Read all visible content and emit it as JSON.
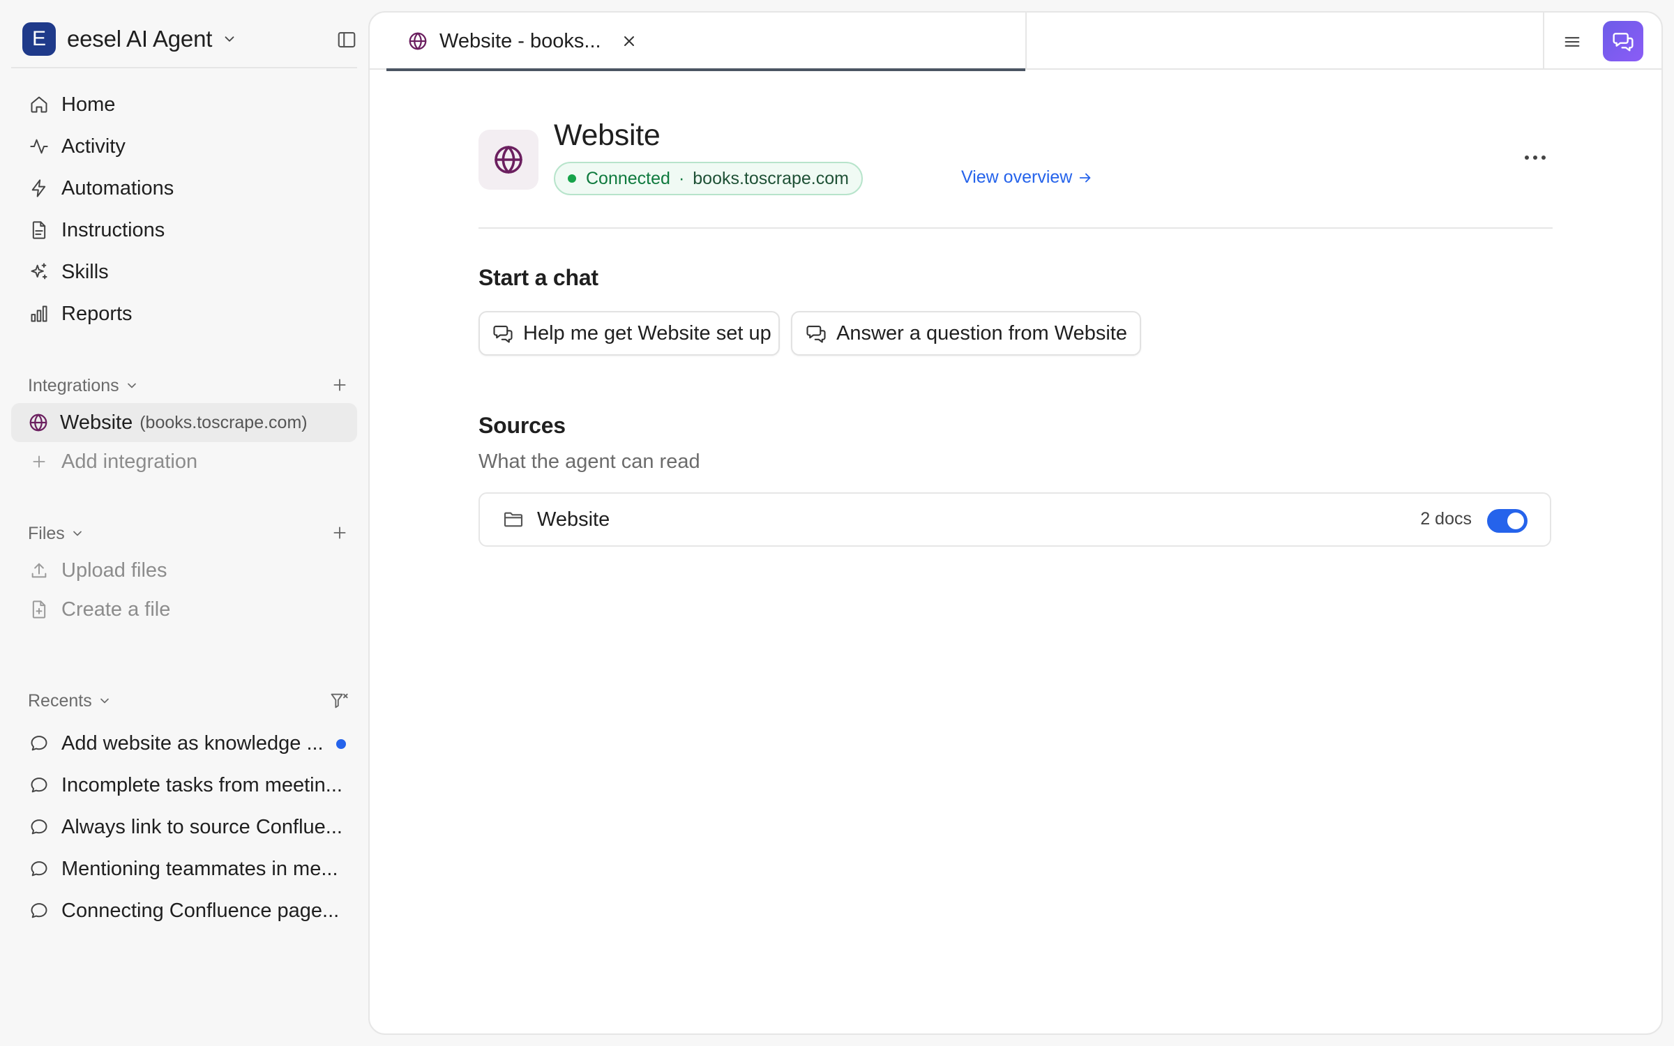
{
  "workspace": {
    "initial": "E",
    "name": "eesel AI Agent"
  },
  "nav": {
    "items": [
      {
        "label": "Home",
        "icon": "home-icon"
      },
      {
        "label": "Activity",
        "icon": "activity-icon"
      },
      {
        "label": "Automations",
        "icon": "lightning-icon"
      },
      {
        "label": "Instructions",
        "icon": "document-icon"
      },
      {
        "label": "Skills",
        "icon": "sparkles-icon"
      },
      {
        "label": "Reports",
        "icon": "bar-chart-icon"
      }
    ]
  },
  "integrations": {
    "heading": "Integrations",
    "items": [
      {
        "label": "Website",
        "sub": "(books.toscrape.com)",
        "icon": "globe-icon"
      }
    ],
    "add_label": "Add integration"
  },
  "files": {
    "heading": "Files",
    "upload_label": "Upload files",
    "create_label": "Create a file"
  },
  "recents": {
    "heading": "Recents",
    "items": [
      {
        "label": "Add website as knowledge ...",
        "unread": true
      },
      {
        "label": "Incomplete tasks from meetin..."
      },
      {
        "label": "Always link to source Conflue..."
      },
      {
        "label": "Mentioning teammates in me..."
      },
      {
        "label": "Connecting Confluence page..."
      }
    ]
  },
  "tab": {
    "label": "Website - books..."
  },
  "page": {
    "title": "Website",
    "status": "Connected",
    "separator": "·",
    "domain": "books.toscrape.com",
    "view_overview": "View overview",
    "start_chat_heading": "Start a chat",
    "chat_buttons": [
      {
        "label": "Help me get Website set up"
      },
      {
        "label": "Answer a question from Website"
      }
    ],
    "sources_heading": "Sources",
    "sources_subtitle": "What the agent can read",
    "sources": [
      {
        "label": "Website",
        "count": "2 docs",
        "enabled": true
      }
    ]
  },
  "colors": {
    "accent": "#2563eb",
    "brand_logo": "#1f3a8a",
    "connected_green": "#16a34a",
    "integration_icon": "#6b1f5f",
    "chat_button_gradient": [
      "#6d5ce8",
      "#8b5cf6"
    ]
  }
}
